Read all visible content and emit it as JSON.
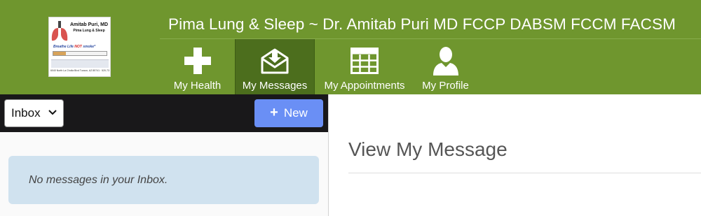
{
  "header": {
    "site_title": "Pima Lung & Sleep ~ Dr. Amitab Puri MD FCCP DABSM FCCM FACSM",
    "logo": {
      "name": "Amitab Puri, MD",
      "subtitle": "Pima Lung & Sleep",
      "tagline_start": "Breathe Life ",
      "tagline_emph": "NOT",
      "tagline_end": " smoke*",
      "footer": "6040 North La Cholla Blvd Tucson, AZ 85741 · 520-733-8879 · www.pimalung.com"
    }
  },
  "nav": {
    "items": [
      {
        "label": "My Health",
        "icon": "plus-cross-icon",
        "active": false
      },
      {
        "label": "My Messages",
        "icon": "envelope-download-icon",
        "active": true
      },
      {
        "label": "My Appointments",
        "icon": "calendar-grid-icon",
        "active": false
      },
      {
        "label": "My Profile",
        "icon": "user-silhouette-icon",
        "active": false
      }
    ]
  },
  "messages": {
    "folder_select": {
      "selected": "Inbox"
    },
    "new_button": {
      "label": "New"
    },
    "empty_text": "No messages in your Inbox."
  },
  "view": {
    "title": "View My Message"
  },
  "colors": {
    "header_bg": "#6f962e",
    "nav_active_bg": "#4c6e1d",
    "toolbar_bg": "#19181a",
    "new_button_bg": "#6a8ff5",
    "empty_alert_bg": "#d0e2ef"
  }
}
